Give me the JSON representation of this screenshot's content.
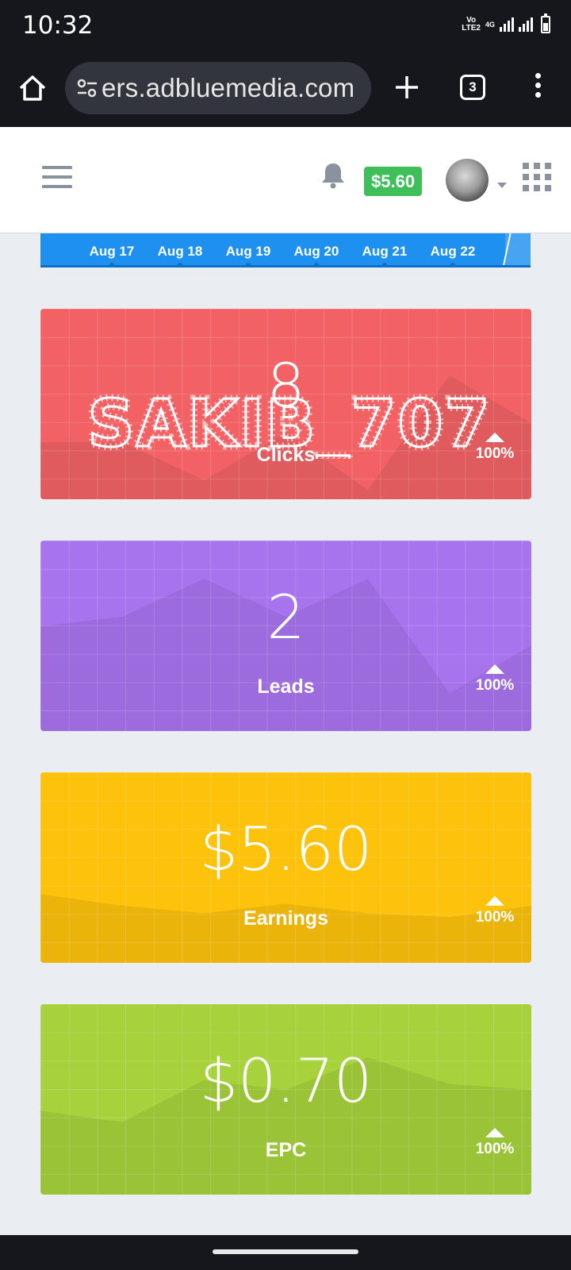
{
  "status_bar": {
    "time": "10:32",
    "volte_label": "Vo\nLTE2",
    "network_label": "4G",
    "icons": [
      "volte-icon",
      "signal-icon",
      "signal-icon",
      "battery-icon"
    ]
  },
  "browser": {
    "url_text": "ers.adbluemedia.com",
    "tab_count": "3",
    "icons": [
      "home-icon",
      "tune-icon",
      "plus-icon",
      "more-vert-icon"
    ]
  },
  "header": {
    "balance": "$5.60",
    "icons": [
      "hamburger-icon",
      "bell-icon",
      "avatar",
      "apps-grid-icon"
    ]
  },
  "chart_strip": {
    "dates": [
      "Aug 17",
      "Aug 18",
      "Aug 19",
      "Aug 20",
      "Aug 21",
      "Aug 22"
    ],
    "color": "#1e90f0"
  },
  "watermark": {
    "text": "SAKIB_707"
  },
  "cards": [
    {
      "value": "8",
      "label": "Clicks",
      "trend": "100%",
      "color": "#f26265",
      "trend_series": [
        0.3,
        0.3,
        0.1,
        0.35,
        0.05,
        0.65,
        0.4
      ]
    },
    {
      "value": "2",
      "label": "Leads",
      "trend": "100%",
      "color": "#a874ee",
      "trend_series": [
        0.55,
        0.6,
        0.8,
        0.6,
        0.8,
        0.2,
        0.45
      ]
    },
    {
      "value": "$5.60",
      "label": "Earnings",
      "trend": "100%",
      "color": "#fdc20c",
      "trend_series": [
        0.36,
        0.3,
        0.26,
        0.31,
        0.26,
        0.24,
        0.3
      ]
    },
    {
      "value": "$0.70",
      "label": "EPC",
      "trend": "100%",
      "color": "#a7d23c",
      "trend_series": [
        0.44,
        0.38,
        0.6,
        0.55,
        0.72,
        0.58,
        0.55
      ]
    }
  ]
}
